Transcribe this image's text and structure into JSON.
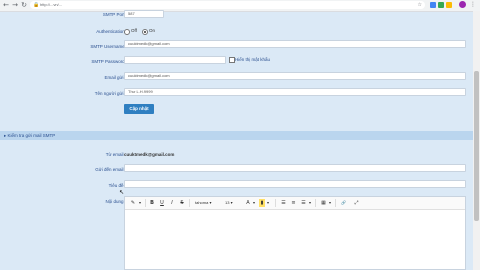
{
  "browser": {
    "back_icon": "←",
    "forward_icon": "→",
    "reload_icon": "↻",
    "url": "http://...vn/...",
    "lock_icon": "🔒",
    "star_icon": "☆",
    "menu_icon": "⋮"
  },
  "form": {
    "smtp_port_label": "SMTP Port:",
    "smtp_port_value": "587",
    "auth_label": "Authentication:",
    "auth_off": "Off",
    "auth_on": "On",
    "smtp_username_label": "SMTP Username:",
    "smtp_username_value": "cuuktmedk@gmail.com",
    "smtp_password_label": "SMTP Password:",
    "smtp_password_value": "",
    "show_password_label": "Hiển thị mật khẩu",
    "sender_email_label": "Email gửi :",
    "sender_email_value": "cuuktmedk@gmail.com",
    "sender_name_label": "Tên người gửi :",
    "sender_name_value": "Thư L.H.9999",
    "update_button": "Cập nhật"
  },
  "test_section": {
    "title": "▸ Kiểm tra gửi mail SMTP",
    "from_label": "Từ email :",
    "from_value": "cuuktmedk@gmail.com",
    "to_label": "Gửi đến email :",
    "to_value": "",
    "subject_label": "Tiêu đề :",
    "subject_value": "",
    "content_label": "Nội dung :",
    "cursor_icon": "↖"
  },
  "editor": {
    "font_family": "tahoma",
    "font_size": "13",
    "tools": {
      "magic": "✎",
      "bold": "B",
      "underline": "U",
      "italic": "I",
      "strike": "S",
      "font_color": "A",
      "highlight": "▮",
      "ul": "☰",
      "ol": "≡",
      "align": "☰",
      "table": "▦",
      "link": "🔗",
      "fullscreen": "⤢"
    }
  }
}
